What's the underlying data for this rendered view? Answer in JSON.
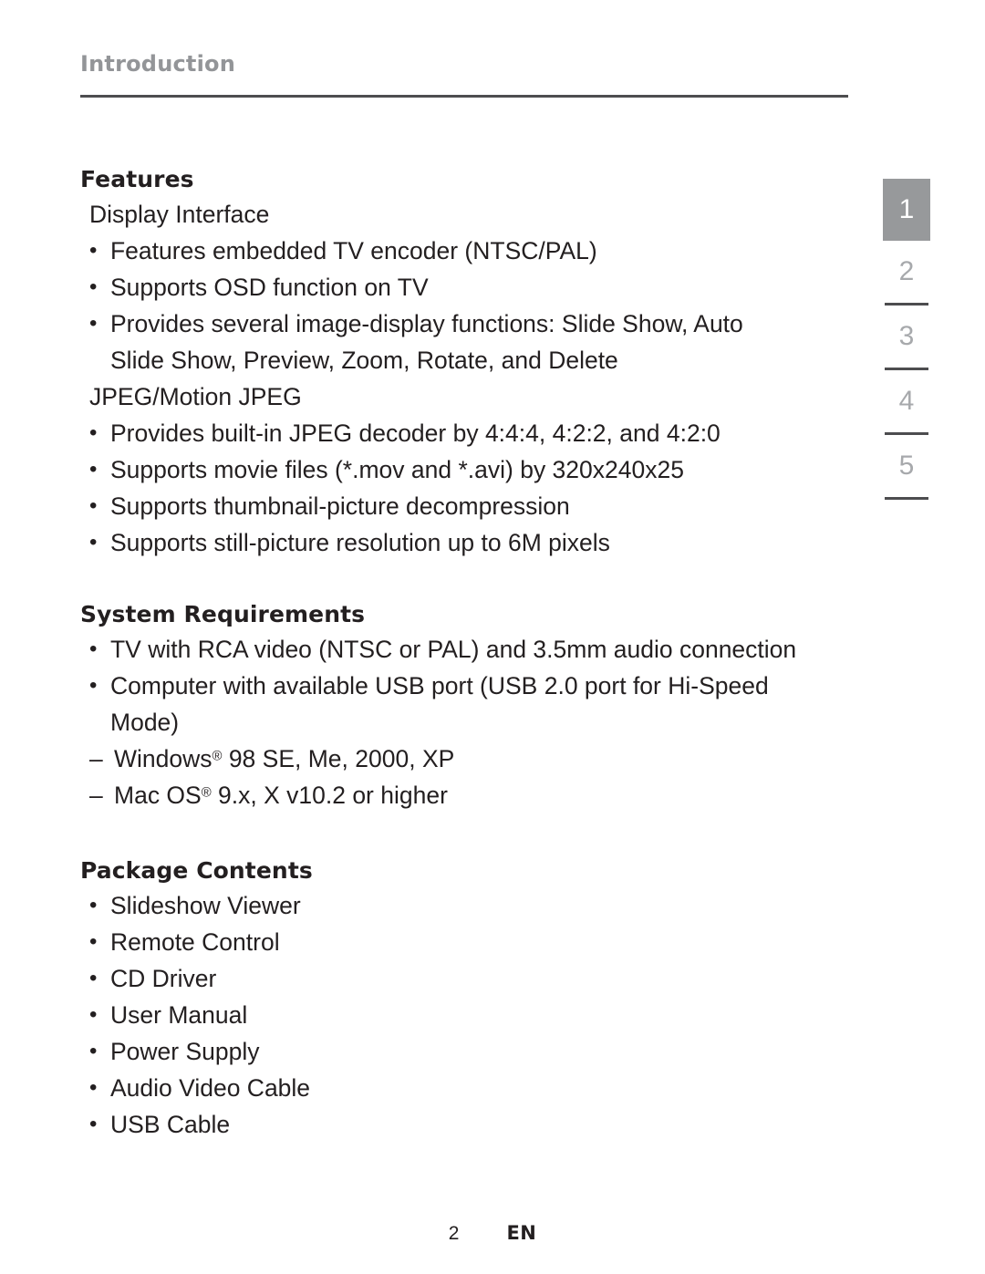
{
  "running_head": "Introduction",
  "sections": [
    {
      "title": "Features",
      "intro_lines": [
        {
          "text": "Display Interface",
          "after_index": -1
        }
      ],
      "groups": [
        {
          "heading": "Display Interface",
          "bullets": [
            {
              "line1": "Features embedded TV encoder (NTSC/PAL)",
              "line2": ""
            },
            {
              "line1": "Supports OSD function on TV",
              "line2": ""
            },
            {
              "line1": "Provides several image-display functions: Slide Show, Auto",
              "line2": "Slide Show, Preview, Zoom, Rotate, and Delete"
            }
          ]
        },
        {
          "heading": "JPEG/Motion JPEG",
          "bullets": [
            {
              "line1": "Provides built-in JPEG decoder by 4:4:4, 4:2:2, and 4:2:0",
              "line2": ""
            },
            {
              "line1": "Supports movie files (*.mov and *.avi) by 320x240x25",
              "line2": ""
            },
            {
              "line1": "Supports thumbnail-picture decompression",
              "line2": ""
            },
            {
              "line1": "Supports still-picture resolution up to 6M pixels",
              "line2": ""
            }
          ]
        }
      ]
    }
  ],
  "system_requirements": {
    "title": "System Requirements",
    "bullets": [
      {
        "line1": "TV with RCA video (NTSC or PAL) and 3.5mm audio connection",
        "line2": ""
      },
      {
        "line1": "Computer with available USB port (USB 2.0 port for Hi-Speed",
        "line2": "Mode)"
      }
    ],
    "dashes": [
      {
        "pre": "Windows",
        "mark": "®",
        "post": " 98 SE, Me, 2000, XP"
      },
      {
        "pre": "Mac OS",
        "mark": "®",
        "post": " 9.x, X v10.2 or higher"
      }
    ]
  },
  "package_contents": {
    "title": "Package Contents",
    "items": [
      "Slideshow Viewer",
      "Remote Control",
      "CD Driver",
      "User Manual",
      "Power Supply",
      "Audio Video Cable",
      "USB Cable"
    ]
  },
  "chapter_tabs": {
    "active_index": 0,
    "labels": [
      "1",
      "2",
      "3",
      "4",
      "5"
    ]
  },
  "footer": {
    "page_number": "2",
    "language": "EN"
  },
  "colors": {
    "running_head": "#939598",
    "rule": "#4d4d4f",
    "text": "#231f20",
    "tab_active_bg": "#97999b",
    "tab_inactive_text": "#a7a9ac"
  }
}
